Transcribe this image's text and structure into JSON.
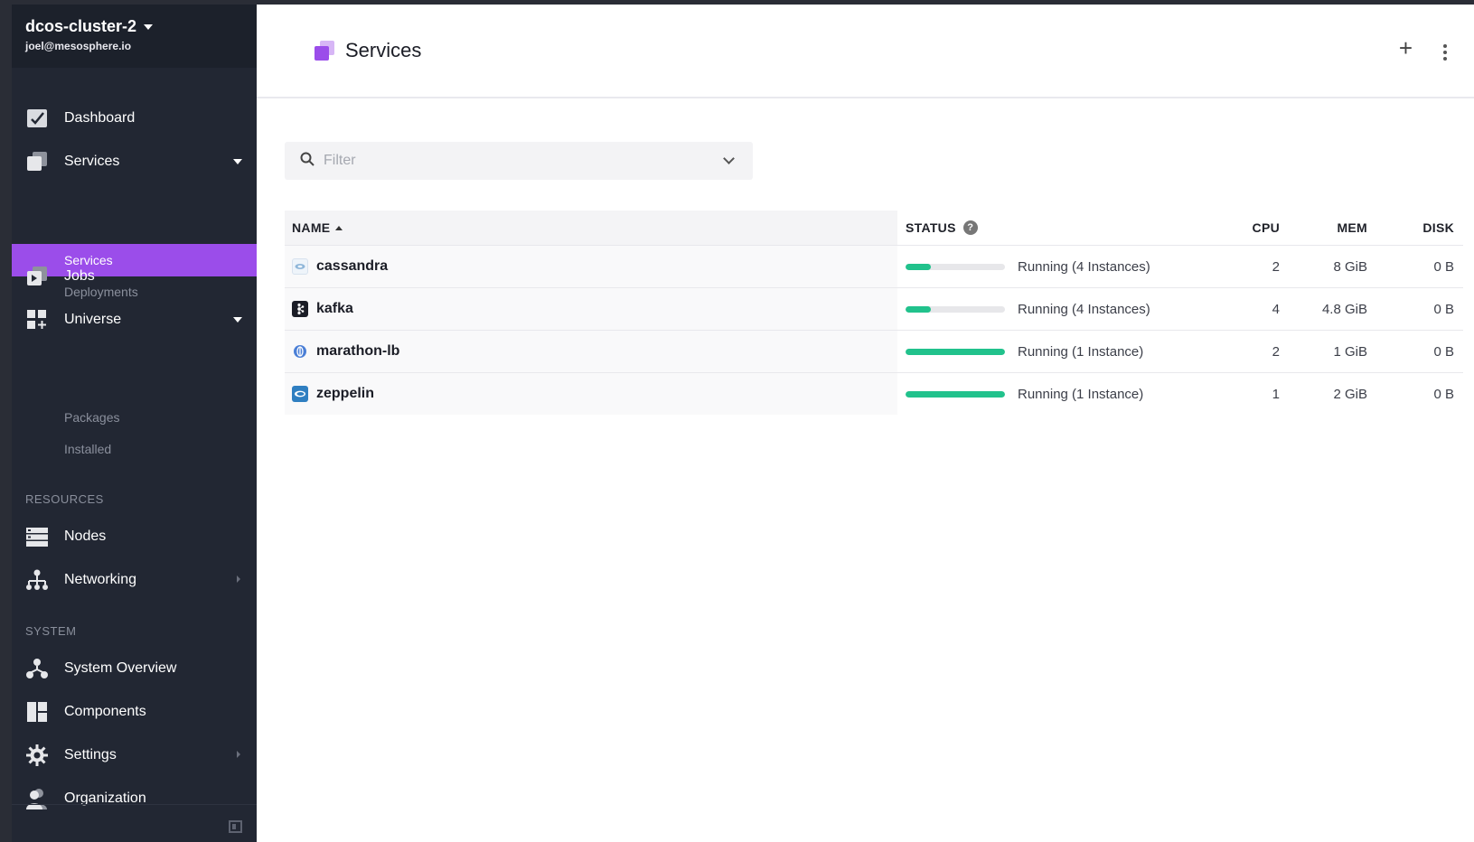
{
  "sidebar": {
    "cluster_name": "dcos-cluster-2",
    "user_email": "joel@mesosphere.io",
    "items": [
      {
        "label": "Dashboard"
      },
      {
        "label": "Services"
      },
      {
        "label": "Jobs"
      },
      {
        "label": "Universe"
      },
      {
        "label": "Nodes"
      },
      {
        "label": "Networking"
      },
      {
        "label": "System Overview"
      },
      {
        "label": "Components"
      },
      {
        "label": "Settings"
      },
      {
        "label": "Organization"
      }
    ],
    "services_sub": [
      {
        "label": "Services"
      },
      {
        "label": "Deployments"
      }
    ],
    "universe_sub": [
      {
        "label": "Packages"
      },
      {
        "label": "Installed"
      }
    ],
    "section_resources": "RESOURCES",
    "section_system": "SYSTEM"
  },
  "header": {
    "title": "Services",
    "add_label": "+"
  },
  "filter": {
    "placeholder": "Filter"
  },
  "table": {
    "columns": {
      "name": "NAME",
      "status": "STATUS",
      "cpu": "CPU",
      "mem": "MEM",
      "disk": "DISK"
    },
    "help": "?",
    "rows": [
      {
        "name": "cassandra",
        "status": "Running (4 Instances)",
        "progress": 0.25,
        "cpu": "2",
        "mem": "8 GiB",
        "disk": "0 B"
      },
      {
        "name": "kafka",
        "status": "Running (4 Instances)",
        "progress": 0.25,
        "cpu": "4",
        "mem": "4.8 GiB",
        "disk": "0 B"
      },
      {
        "name": "marathon-lb",
        "status": "Running (1 Instance)",
        "progress": 1.0,
        "cpu": "2",
        "mem": "1 GiB",
        "disk": "0 B"
      },
      {
        "name": "zeppelin",
        "status": "Running (1 Instance)",
        "progress": 1.0,
        "cpu": "1",
        "mem": "2 GiB",
        "disk": "0 B"
      }
    ]
  },
  "colors": {
    "accent": "#9b4dea",
    "progress": "#21c28c",
    "sidebar": "#222733"
  }
}
